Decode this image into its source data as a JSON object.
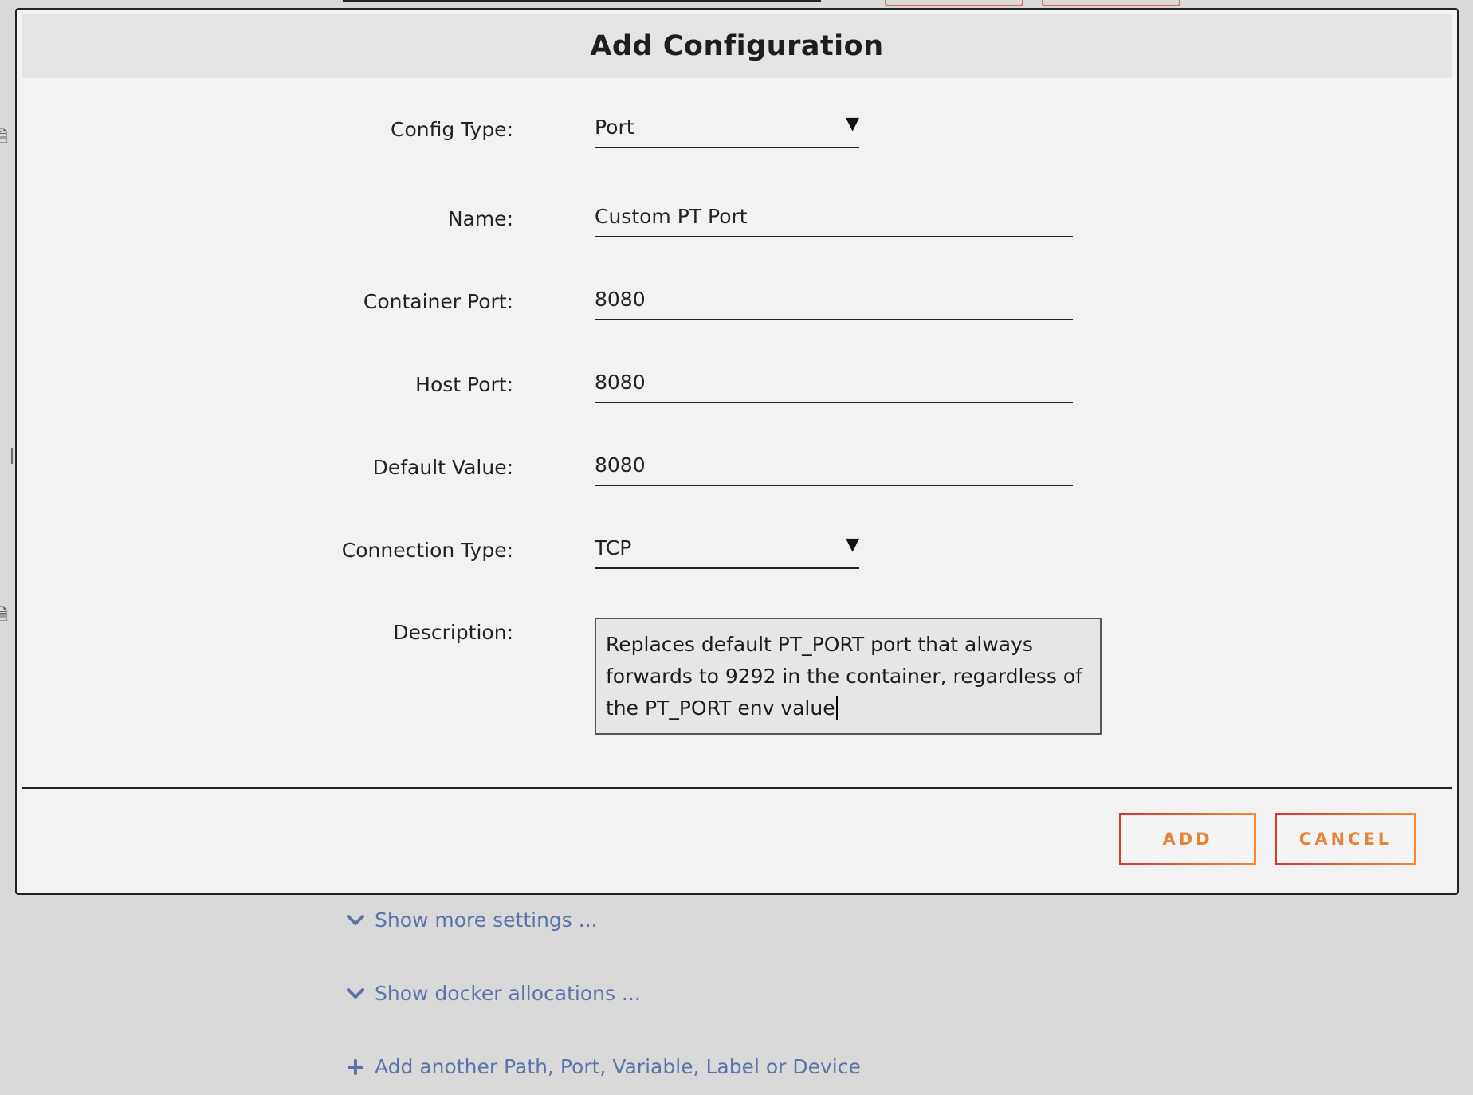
{
  "dialog": {
    "title": "Add Configuration"
  },
  "form": {
    "config_type": {
      "label": "Config Type:",
      "value": "Port"
    },
    "name": {
      "label": "Name:",
      "value": "Custom PT Port"
    },
    "container_port": {
      "label": "Container Port:",
      "value": "8080"
    },
    "host_port": {
      "label": "Host Port:",
      "value": "8080"
    },
    "default_value": {
      "label": "Default Value:",
      "value": "8080"
    },
    "connection_type": {
      "label": "Connection Type:",
      "value": "TCP"
    },
    "description": {
      "label": "Description:",
      "value": "Replaces default PT_PORT port that always forwards to 9292 in the container, regardless of the PT_PORT env value"
    }
  },
  "buttons": {
    "add_label": "ADD",
    "cancel_label": "CANCEL"
  },
  "links": {
    "more_settings": "Show more settings ...",
    "docker_allocations": "Show docker allocations ...",
    "add_another": "Add another Path, Port, Variable, Label or Device"
  },
  "icons": {
    "dropdown": "caret-down-icon",
    "expand": "chevron-down-icon",
    "add": "plus-icon"
  },
  "colors": {
    "accent_orange": "#e8823a",
    "accent_red": "#d33a2a",
    "link_blue": "#5a74a8"
  }
}
